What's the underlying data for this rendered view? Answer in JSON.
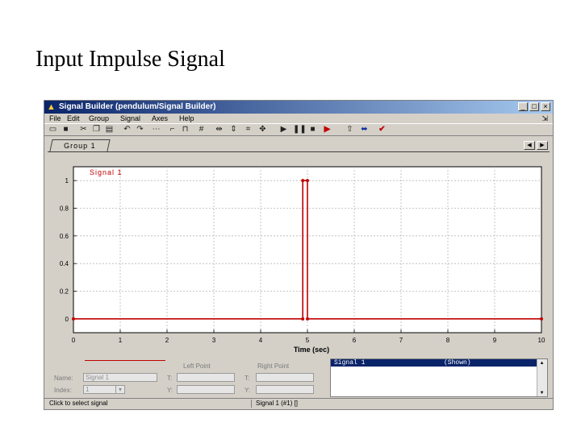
{
  "slide": {
    "title": "Input Impulse Signal"
  },
  "window": {
    "title": "Signal Builder (pendulum/Signal Builder)",
    "controls": {
      "minimize": "_",
      "maximize": "□",
      "close": "×"
    }
  },
  "menu": {
    "items": [
      "File",
      "Edit",
      "Group",
      "Signal",
      "Axes",
      "Help"
    ]
  },
  "toolbar": {
    "icons": [
      "open-icon",
      "save-icon",
      "cut-icon",
      "copy-icon",
      "paste-icon",
      "undo-icon",
      "redo-icon",
      "constant-icon",
      "step-icon",
      "pulse-icon",
      "grid-icon",
      "zoom-x-icon",
      "zoom-y-icon",
      "zoom-fit-icon",
      "pan-icon",
      "play-icon",
      "pause-icon",
      "stop-icon",
      "play-all-icon",
      "scope-icon",
      "model-icon",
      "verify-icon"
    ]
  },
  "tabs": {
    "group": "Group 1"
  },
  "chart_data": {
    "type": "line",
    "series": [
      {
        "name": "Signal 1",
        "x": [
          0,
          4.9,
          4.9,
          5.0,
          5.0,
          10
        ],
        "y": [
          0,
          0,
          1,
          1,
          0,
          0
        ]
      }
    ],
    "xlabel": "Time (sec)",
    "xlim": [
      0,
      10
    ],
    "ylim": [
      -0.1,
      1.1
    ],
    "xticks": [
      "0",
      "1",
      "2",
      "3",
      "4",
      "5",
      "6",
      "7",
      "8",
      "9",
      "10"
    ],
    "yticks": [
      "0",
      "0.2",
      "0.4",
      "0.6",
      "0.8",
      "1"
    ],
    "grid": true,
    "color": "#c00000"
  },
  "editor": {
    "left_point": "Left Point",
    "right_point": "Right Point",
    "name_label": "Name:",
    "name_value": "Signal 1",
    "index_label": "Index:",
    "index_value": "1",
    "t_label": "T:",
    "y_label": "Y:"
  },
  "signal_list": {
    "name": "Signal 1",
    "status": "(Shown)"
  },
  "status": {
    "left": "Click to select signal",
    "right": "Signal 1 (#1) []"
  }
}
